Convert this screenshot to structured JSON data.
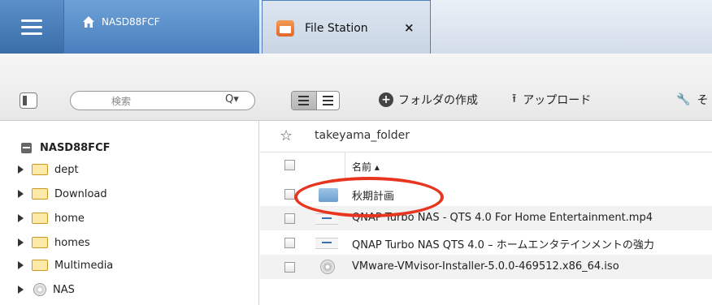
{
  "topbar": {
    "home_tab": "NASD88FCF",
    "active_tab": "File Station",
    "close_glyph": "×"
  },
  "toolbar": {
    "search_placeholder": "検索",
    "search_icon": "Q▾",
    "new_folder": "フォルダの作成",
    "plus_glyph": "+",
    "upload": "アップロード",
    "upload_glyph": "⭱",
    "tools_glyph": "🔧",
    "tools_label": "そ"
  },
  "sidebar": {
    "root": "NASD88FCF",
    "items": [
      {
        "label": "dept",
        "icon": "folder-icon"
      },
      {
        "label": "Download",
        "icon": "folder-icon"
      },
      {
        "label": "home",
        "icon": "folder-icon"
      },
      {
        "label": "homes",
        "icon": "folder-icon"
      },
      {
        "label": "Multimedia",
        "icon": "folder-icon"
      },
      {
        "label": "NAS",
        "icon": "disc-icon"
      }
    ]
  },
  "main": {
    "star_glyph": "☆",
    "current_folder": "takeyama_folder",
    "column_name": "名前 ▴",
    "files": [
      {
        "name": "秋期計画",
        "type": "folder"
      },
      {
        "name": "QNAP Turbo NAS - QTS 4.0 For Home Entertainment.mp4",
        "type": "video"
      },
      {
        "name": "QNAP Turbo NAS QTS 4.0 – ホームエンタテインメントの強力",
        "type": "video"
      },
      {
        "name": "VMware-VMvisor-Installer-5.0.0-469512.x86_64.iso",
        "type": "disc"
      }
    ]
  },
  "colors": {
    "accent": "#4a7fbf",
    "highlight": "#e8351f"
  }
}
